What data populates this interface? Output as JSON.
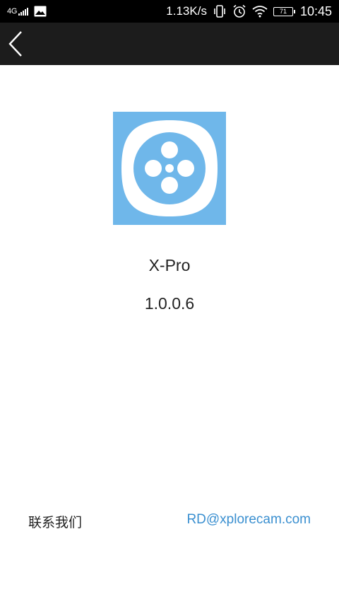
{
  "status_bar": {
    "network": "4G",
    "net_speed": "1.13K/s",
    "battery": "71",
    "time": "10:45",
    "icons": [
      "signal-icon",
      "image-notification-icon",
      "vibrate-icon",
      "alarm-icon",
      "wifi-icon",
      "battery-icon"
    ]
  },
  "nav": {
    "back_icon": "chevron-left-icon"
  },
  "app": {
    "name": "X-Pro",
    "version": "1.0.0.6",
    "icon_bg": "#6fb7ea",
    "icon_accent": "#ffffff"
  },
  "contact": {
    "label": "联系我们",
    "email": "RD@xplorecam.com",
    "email_color": "#3a8fd0"
  }
}
